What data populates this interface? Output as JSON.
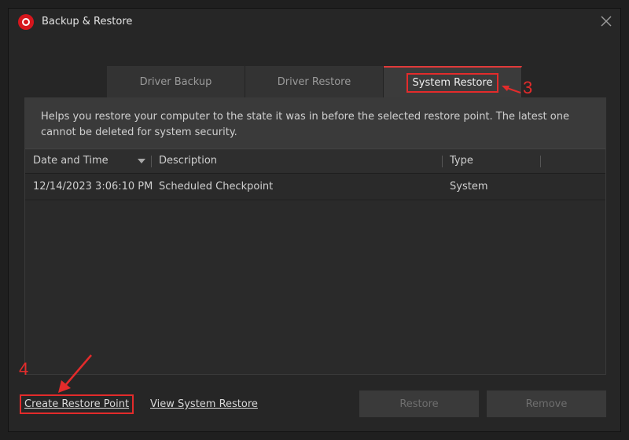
{
  "window": {
    "title": "Backup & Restore",
    "close_icon": "close-icon"
  },
  "tabs": [
    {
      "label": "Driver Backup",
      "active": false
    },
    {
      "label": "Driver Restore",
      "active": false
    },
    {
      "label": "System Restore",
      "active": true
    }
  ],
  "info_text": "Helps you restore your computer to the state it was in before the selected restore point. The latest one cannot be deleted for system security.",
  "table": {
    "columns": [
      "Date and Time",
      "Description",
      "Type"
    ],
    "rows": [
      {
        "date": "12/14/2023 3:06:10 PM",
        "description": "Scheduled Checkpoint",
        "type": "System"
      }
    ]
  },
  "links": {
    "create": "Create Restore Point",
    "view": "View System Restore"
  },
  "buttons": {
    "restore": "Restore",
    "remove": "Remove"
  },
  "annotations": {
    "step3": "3",
    "step4": "4"
  },
  "colors": {
    "accent_red": "#e32b2b",
    "background": "#262626"
  }
}
